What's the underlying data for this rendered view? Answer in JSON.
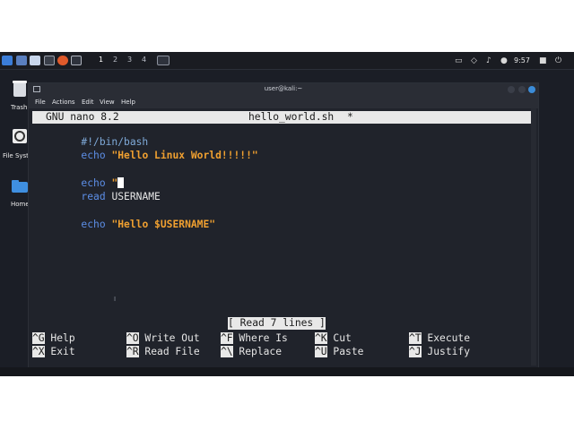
{
  "taskbar": {
    "workspaces": [
      "1",
      "2",
      "3",
      "4"
    ],
    "clock": "9:57",
    "icons": [
      "kali-menu-icon",
      "show-desktop-icon",
      "file-manager-icon",
      "terminal-icon",
      "browser-icon",
      "text-editor-icon"
    ]
  },
  "desktop": {
    "icons": [
      {
        "name": "trash",
        "label": "Trash"
      },
      {
        "name": "file-system",
        "label": "File Syst"
      },
      {
        "name": "home",
        "label": "Home"
      }
    ]
  },
  "window": {
    "title": "user@kali:~",
    "menu": [
      "File",
      "Actions",
      "Edit",
      "View",
      "Help"
    ]
  },
  "nano": {
    "version": "GNU nano 8.2",
    "filename": "hello_world.sh",
    "modified": "*",
    "lines": {
      "l1": "#!/bin/bash",
      "l2_cmd": "echo",
      "l2_str": "\"Hello Linux World!!!!!\"",
      "l4_cmd": "echo",
      "l4_str": "\"",
      "l5_cmd": "read",
      "l5_arg": "USERNAME",
      "l7_cmd": "echo",
      "l7_str": "\"Hello $USERNAME\""
    },
    "status": "[ Read 7 lines ]",
    "shortcuts": [
      {
        "key": "^G",
        "label": "Help"
      },
      {
        "key": "^X",
        "label": "Exit"
      },
      {
        "key": "^O",
        "label": "Write Out"
      },
      {
        "key": "^R",
        "label": "Read File"
      },
      {
        "key": "^F",
        "label": "Where Is"
      },
      {
        "key": "^\\",
        "label": "Replace"
      },
      {
        "key": "^K",
        "label": "Cut"
      },
      {
        "key": "^U",
        "label": "Paste"
      },
      {
        "key": "^T",
        "label": "Execute"
      },
      {
        "key": "^J",
        "label": "Justify"
      }
    ]
  },
  "colors": {
    "keyword": "#5c8ee6",
    "string": "#f0a030",
    "close_button": "#3b8cd8"
  }
}
